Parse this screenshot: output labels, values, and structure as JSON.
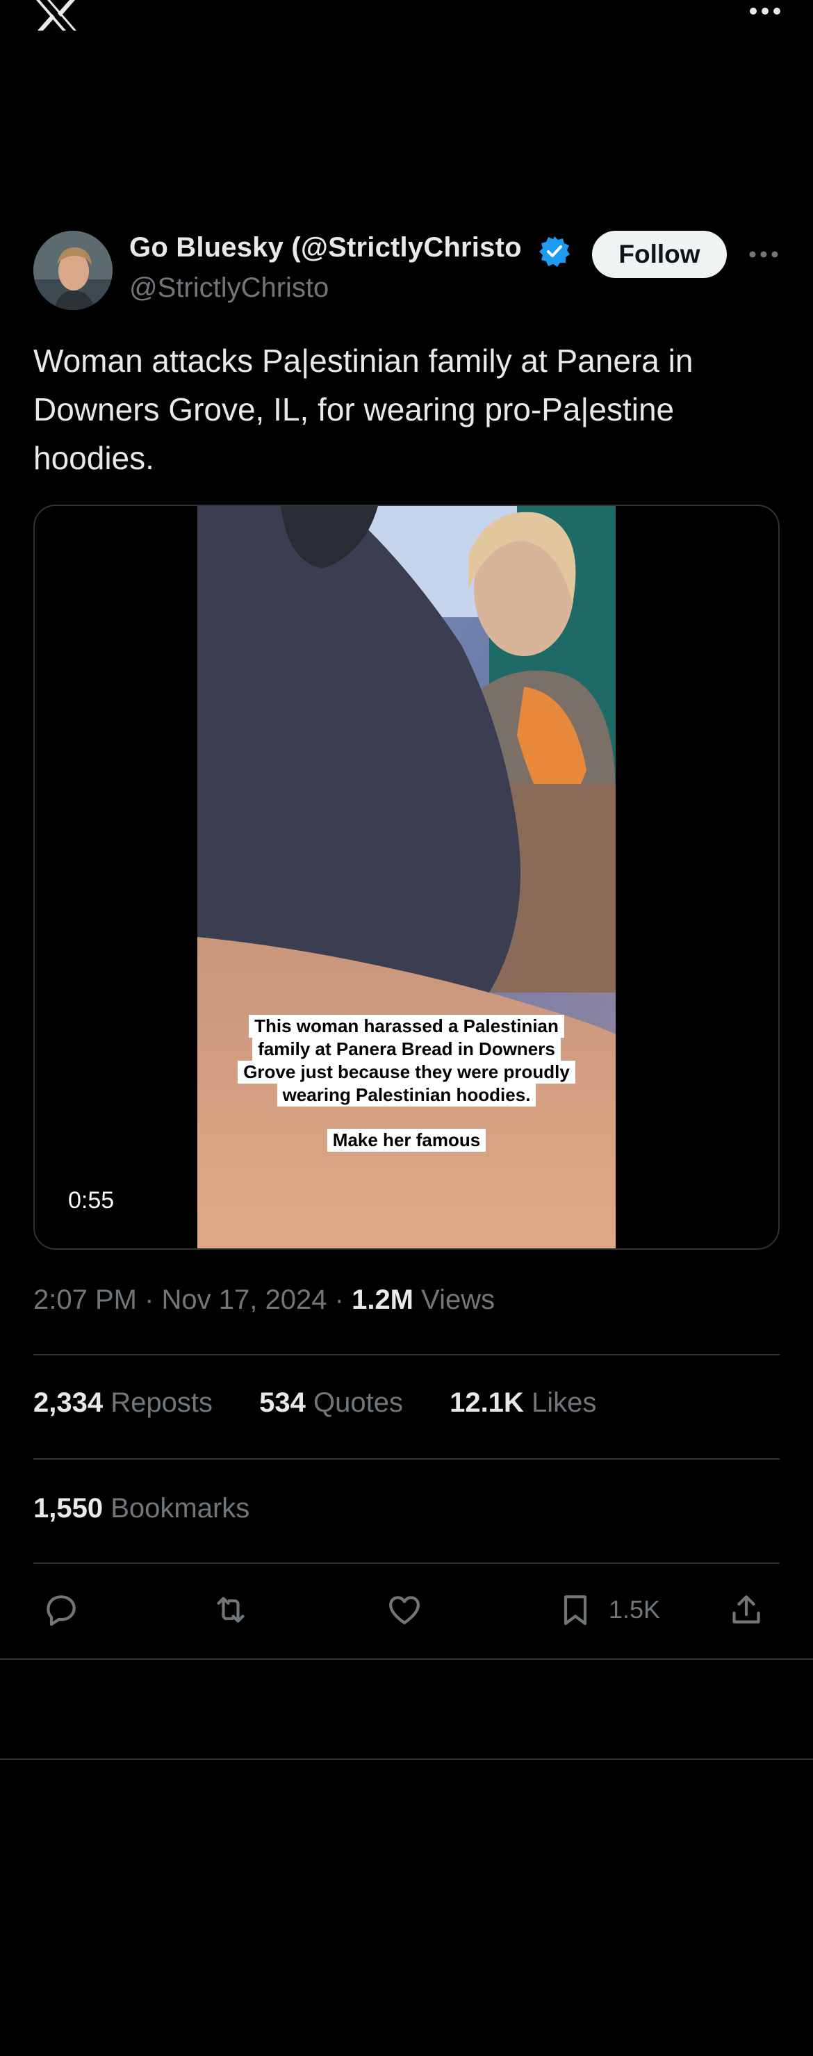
{
  "app": {
    "logo_icon": "x-logo-icon",
    "menu_icon": "more-icon"
  },
  "author": {
    "display_name": "Go Bluesky (@StrictlyChristo",
    "handle": "@StrictlyChristo",
    "verified": true,
    "verified_color": "#1d9bf0",
    "follow_label": "Follow"
  },
  "tweet": {
    "text": "Woman attacks Pa|estinian family at Panera in Downers Grove, IL, for wearing pro-Pa|estine hoodies.",
    "video": {
      "duration": "0:55",
      "caption_lines": [
        "This woman harassed a Palestinian",
        "family at Panera Bread in Downers",
        "Grove just because they were proudly",
        "wearing Palestinian hoodies."
      ],
      "caption_sub": "Make her famous"
    },
    "time": "2:07 PM",
    "date": "Nov 17, 2024",
    "separator": "·",
    "views_count": "1.2M",
    "views_label": "Views"
  },
  "stats": {
    "reposts": {
      "count": "2,334",
      "label": "Reposts"
    },
    "quotes": {
      "count": "534",
      "label": "Quotes"
    },
    "likes": {
      "count": "12.1K",
      "label": "Likes"
    },
    "bookmarks": {
      "count": "1,550",
      "label": "Bookmarks"
    }
  },
  "actions": {
    "reply_icon": "reply-icon",
    "repost_icon": "repost-icon",
    "like_icon": "heart-icon",
    "bookmark_icon": "bookmark-icon",
    "bookmark_count": "1.5K",
    "share_icon": "share-icon"
  },
  "colors": {
    "background": "#000000",
    "text": "#e7e9ea",
    "muted": "#71767b",
    "border": "#2f3336",
    "accent": "#1d9bf0"
  }
}
